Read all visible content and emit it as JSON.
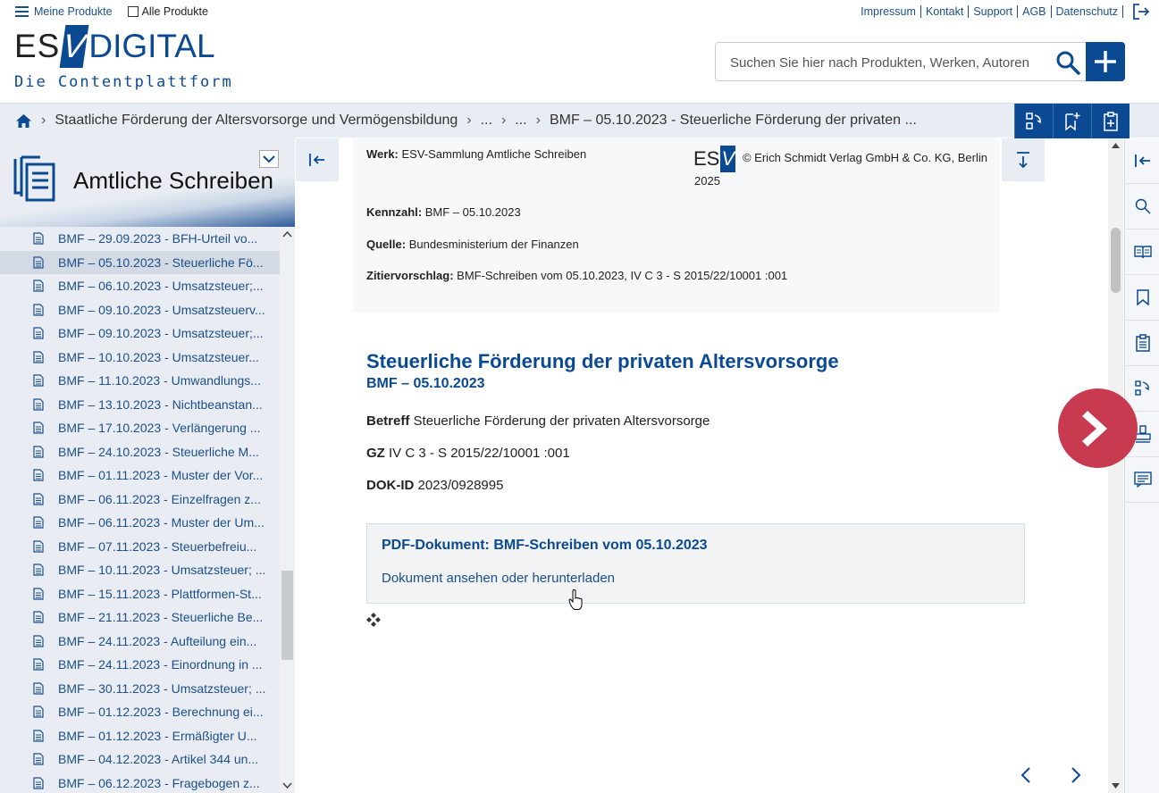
{
  "topbar": {
    "my_products": "Meine Produkte",
    "all_products": "Alle Produkte",
    "links": [
      "Impressum",
      "Kontakt",
      "Support",
      "AGB",
      "Datenschutz"
    ]
  },
  "logo": {
    "es": "ES",
    "v": "V",
    "digital": "DIGITAL",
    "subtitle": "Die Contentplattform"
  },
  "search": {
    "placeholder": "Suchen Sie hier nach Produkten, Werken, Autoren"
  },
  "breadcrumb": {
    "items": [
      "Staatliche Förderung der Altersvorsorge und Vermögensbildung",
      "...",
      "...",
      "BMF – 05.10.2023 - Steuerliche Förderung der privaten ..."
    ]
  },
  "sidebar": {
    "title": "Amtliche Schreiben",
    "items": [
      "BMF – 29.09.2023 - BFH-Urteil vo...",
      "BMF – 05.10.2023 - Steuerliche Fö...",
      "BMF – 06.10.2023 - Umsatzsteuer;...",
      "BMF – 09.10.2023 - Umsatzsteuerv...",
      "BMF – 09.10.2023 - Umsatzsteuer;...",
      "BMF – 10.10.2023 - Umsatzsteuer...",
      "BMF – 11.10.2023 - Umwandlungs...",
      "BMF – 13.10.2023 - Nichtbeanstan...",
      "BMF – 17.10.2023 - Verlängerung ...",
      "BMF – 24.10.2023 - Steuerliche M...",
      "BMF – 01.11.2023 - Muster der Vor...",
      "BMF – 06.11.2023 - Einzelfragen z...",
      "BMF – 06.11.2023 - Muster der Um...",
      "BMF – 07.11.2023 - Steuerbefreiu...",
      "BMF – 10.11.2023 - Umsatzsteuer; ...",
      "BMF – 15.11.2023 - Plattformen-St...",
      "BMF – 21.11.2023 - Steuerliche Be...",
      "BMF – 24.11.2023 - Aufteilung ein...",
      "BMF – 24.11.2023 - Einordnung in ...",
      "BMF – 30.11.2023 - Umsatzsteuer; ...",
      "BMF – 01.12.2023 - Berechnung ei...",
      "BMF – 01.12.2023 - Ermäßigter U...",
      "BMF – 04.12.2023 - Artikel 344 un...",
      "BMF – 06.12.2023 - Fragebogen z..."
    ],
    "active_index": 1
  },
  "meta": {
    "werk_label": "Werk:",
    "werk": "ESV-Sammlung Amtliche Schreiben",
    "copyright_logo": "ESV",
    "copyright": "© Erich Schmidt Verlag GmbH & Co. KG, Berlin",
    "year": "2025",
    "kennzahl_label": "Kennzahl:",
    "kennzahl": "BMF – 05.10.2023",
    "quelle_label": "Quelle:",
    "quelle": "Bundesministerium der Finanzen",
    "zitier_label": "Zitiervorschlag:",
    "zitier": "BMF-Schreiben vom 05.10.2023, IV C 3 - S 2015/22/10001 :001"
  },
  "document": {
    "title": "Steuerliche Förderung der privaten Altersvorsorge",
    "subtitle": "BMF – 05.10.2023",
    "betreff_label": "Betreff",
    "betreff": "Steuerliche Förderung der privaten Altersvorsorge",
    "gz_label": "GZ",
    "gz": "IV C 3 - S 2015/22/10001 :001",
    "dokid_label": "DOK-ID",
    "dokid": "2023/0928995",
    "pdf_title": "PDF-Dokument: BMF-Schreiben vom 05.10.2023",
    "pdf_link": "Dokument ansehen oder herunterladen"
  },
  "colors": {
    "brand": "#0b4a93",
    "next_button": "#c83a4f"
  }
}
